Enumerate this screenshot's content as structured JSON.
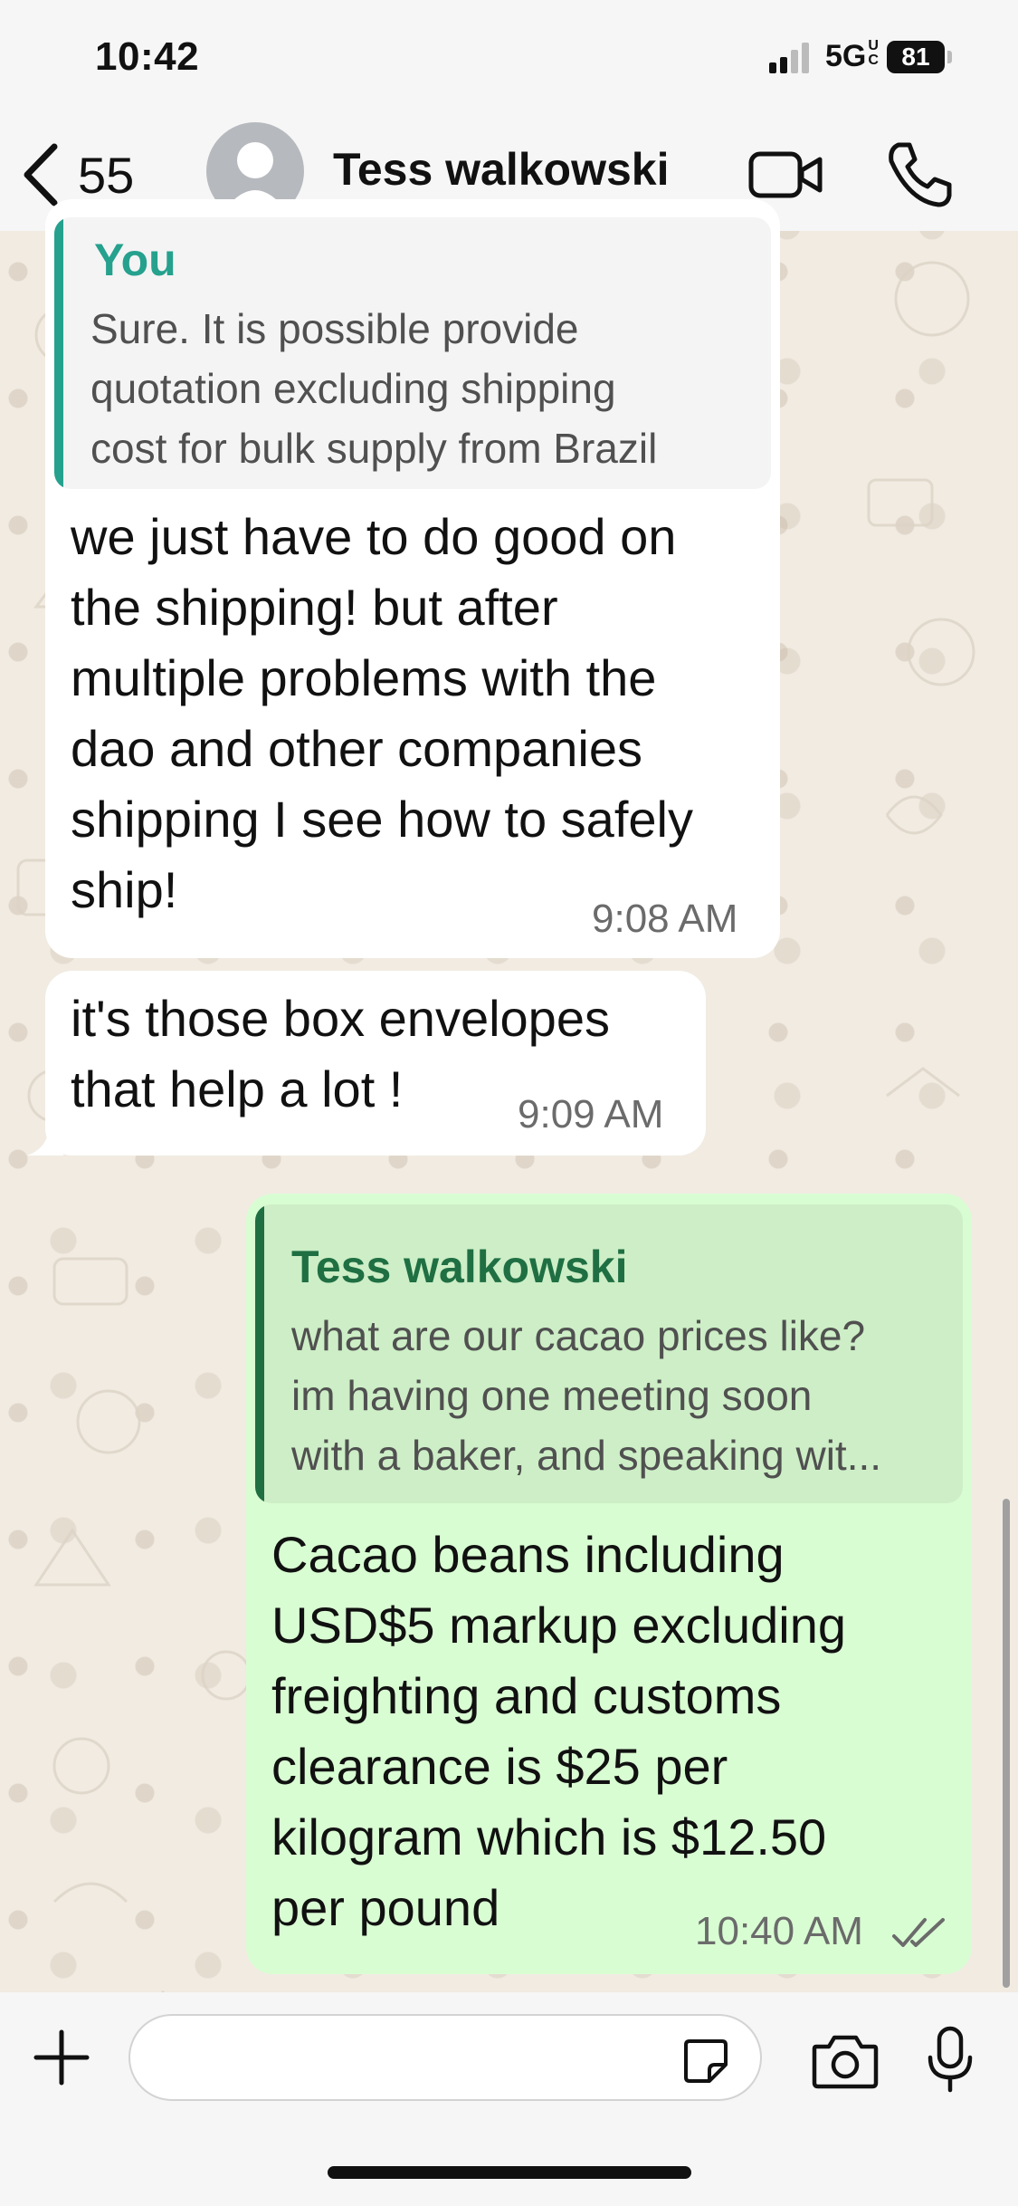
{
  "status_bar": {
    "time": "10:42",
    "network": "5G",
    "network_suffix": "UC",
    "battery": "81"
  },
  "header": {
    "back_count": "55",
    "contact_name": "Tess walkowski"
  },
  "messages": [
    {
      "direction": "incoming",
      "quote": {
        "author": "You",
        "text": [
          "Sure. It is possible provide",
          "quotation excluding shipping",
          "cost for bulk supply from Brazil"
        ]
      },
      "lines": [
        "we just have to do good on",
        "the shipping! but after",
        "multiple problems with the",
        "dao and other companies",
        "shipping I see how to safely",
        "ship!"
      ],
      "time": "9:08 AM"
    },
    {
      "direction": "incoming",
      "lines": [
        "it's those box envelopes",
        "that help a lot !"
      ],
      "time": "9:09 AM"
    },
    {
      "direction": "outgoing",
      "quote": {
        "author": "Tess walkowski",
        "text": [
          "what are our cacao prices like?",
          "im having one meeting soon",
          "with a baker, and speaking wit..."
        ]
      },
      "lines": [
        "Cacao beans including",
        "USD$5 markup excluding",
        "freighting and customs",
        "clearance is $25 per",
        "kilogram which is $12.50",
        "per pound"
      ],
      "time": "10:40 AM",
      "status": "read"
    }
  ],
  "colors": {
    "accent_green": "#25a18e",
    "outgoing_bubble": "#d9fdd3",
    "quote_author_out": "#1f6f43",
    "read_ticks": "#6b6b6b"
  },
  "icons": {
    "back": "chevron-left-icon",
    "avatar": "default-avatar-icon",
    "video": "video-camera-icon",
    "call": "phone-icon",
    "attach": "plus-icon",
    "sticker": "sticker-icon",
    "camera": "camera-icon",
    "mic": "microphone-icon"
  }
}
